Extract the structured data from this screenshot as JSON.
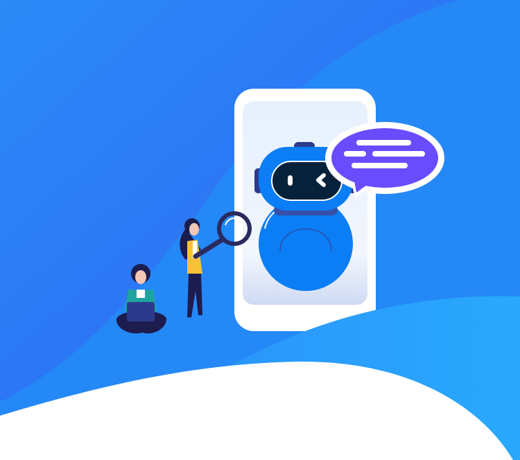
{
  "colors": {
    "bg_top": "#2d5ff4",
    "bg_wave": "#2789f7",
    "hill": "#28a6fc",
    "foreground": "#ffffff",
    "phone_frame": "#ffffff",
    "phone_screen": "#e4effc",
    "robot_blue": "#0b7df5",
    "robot_visor": "#06213a",
    "robot_dark": "#2c3a8c",
    "bubble": "#6a4cff",
    "jacket": "#f5c23a",
    "navy": "#1c1c4e",
    "teal": "#1fa3a0"
  }
}
